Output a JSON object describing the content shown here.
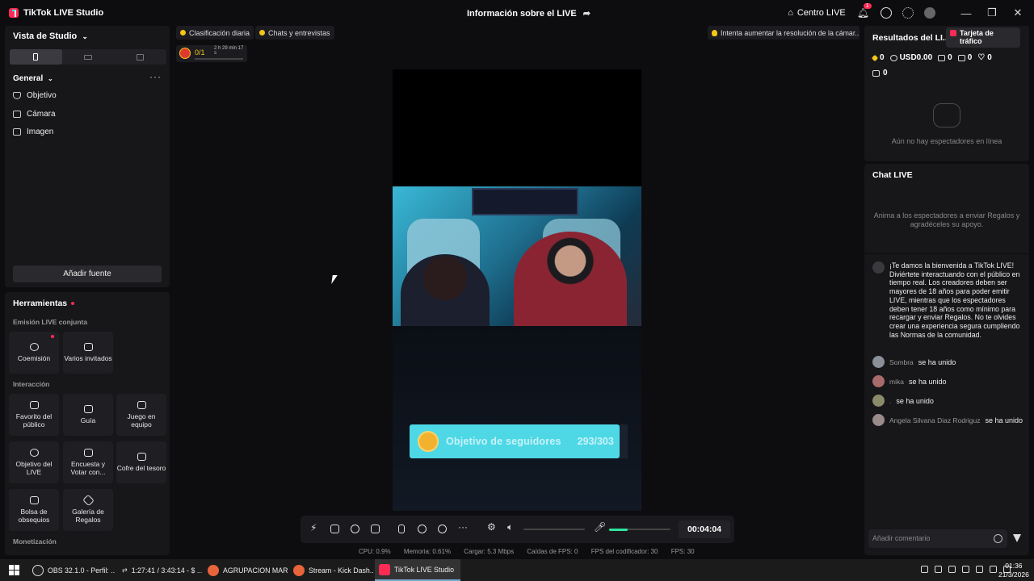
{
  "titlebar": {
    "app_name": "TikTok LIVE Studio",
    "live_info": "Información sobre el LIVE",
    "live_center": "Centro LIVE",
    "notification_count": "1"
  },
  "studio": {
    "view_label": "Vista de Studio",
    "general_label": "General",
    "sources": [
      "Objetivo",
      "Cámara",
      "Imagen"
    ],
    "add_source": "Añadir fuente"
  },
  "tools": {
    "title": "Herramientas",
    "sections": {
      "joint": "Emisión LIVE conjunta",
      "interaction": "Interacción",
      "monetization": "Monetización"
    },
    "joint_items": [
      "Coemisión",
      "Varios invitados"
    ],
    "interaction_items": [
      "Favorito del público",
      "Guía",
      "Juego en equipo",
      "Objetivo del LIVE",
      "Encuesta y Votar con...",
      "Cofre del tesoro",
      "Bolsa de obsequios",
      "Galería de Regalos"
    ]
  },
  "overlays": {
    "daily_ranking": "Clasificación diaria",
    "chats": "Chats y entrevistas",
    "rank_value": "0/1",
    "rank_time": "2 h 29 min 17 s",
    "hint": "Intenta aumentar la resolución de la cámar..."
  },
  "goal": {
    "label": "Objetivo de seguidores",
    "count": "293/303",
    "progress": 0.967
  },
  "controls": {
    "timer": "00:04:04",
    "volume_level": 0.0,
    "mic_level": 0.3
  },
  "stats": {
    "cpu": "CPU: 0.9%",
    "memory": "Memoria: 0.61%",
    "upload": "Cargar: 5.3 Mbps",
    "fps_drops": "Caídas de FPS: 0",
    "encoder_fps": "FPS del codificador: 30",
    "fps": "FPS: 30"
  },
  "results": {
    "title": "Resultados del LI...",
    "traffic_card": "Tarjeta de tráfico",
    "diamonds": "0",
    "usd": "USD0.00",
    "viewers": "0",
    "followers": "0",
    "likes": "0",
    "gifts": "0",
    "no_viewers": "Aún no hay espectadores en línea"
  },
  "chat": {
    "title": "Chat LIVE",
    "prompt": "Anima a los espectadores a enviar Regalos y agradéceles su apoyo.",
    "system_message": "¡Te damos la bienvenida a TikTok LIVE! Diviértete interactuando con el público en tiempo real. Los creadores deben ser mayores de 18 años para poder emitir LIVE, mientras que los espectadores deben tener 18 años como mínimo para recargar y enviar Regalos. No te olvides crear una experiencia segura cumpliendo las Normas de la comunidad.",
    "joins": [
      {
        "name": "Sombra",
        "verb": "se ha unido"
      },
      {
        "name": "mika",
        "verb": "se ha unido"
      },
      {
        "name": ".",
        "verb": "se ha unido"
      },
      {
        "name": "Angela Silvana Diaz Rodriguz",
        "verb": "se ha unido"
      }
    ],
    "comment_placeholder": "Añadir comentario"
  },
  "taskbar": {
    "items": [
      "OBS 32.1.0 - Perfil: ...",
      "1:27:41 / 3:43:14 - $ ...",
      "AGRUPACION MAR...",
      "Stream - Kick Dash...",
      "TikTok LIVE Studio"
    ],
    "time": "01:36",
    "date": "21/3/2026"
  },
  "colors": {
    "accent": "#fe2c55",
    "mic_level": "#2ee59d",
    "goal_bar": "#4ed8e6"
  }
}
